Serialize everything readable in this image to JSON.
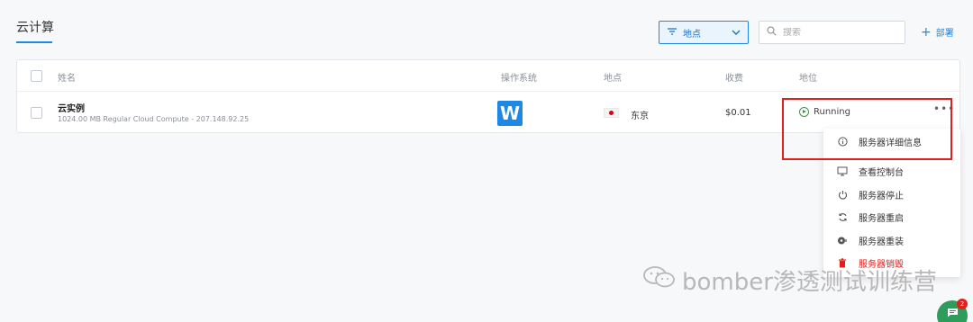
{
  "header": {
    "tab_title": "云计算",
    "filter_label": "地点",
    "search_placeholder": "搜索",
    "deploy_label": "部署"
  },
  "table": {
    "columns": [
      "姓名",
      "操作系统",
      "地点",
      "收费",
      "地位"
    ],
    "rows": [
      {
        "name": "云实例",
        "description": "1024.00 MB Regular Cloud Compute - 207.148.92.25",
        "os_logo": "W",
        "location": "东京",
        "fee": "$0.01",
        "status": "Running"
      }
    ]
  },
  "menu": {
    "items": [
      {
        "label": "服务器详细信息",
        "icon": "info-icon"
      },
      {
        "label": "查看控制台",
        "icon": "monitor-icon"
      },
      {
        "label": "服务器停止",
        "icon": "power-icon"
      },
      {
        "label": "服务器重启",
        "icon": "restart-icon"
      },
      {
        "label": "服务器重装",
        "icon": "reinstall-icon"
      },
      {
        "label": "服务器销毁",
        "icon": "trash-icon"
      }
    ]
  },
  "watermark": "bomber渗透测试训练营",
  "chat": {
    "badge_count": "2"
  },
  "colors": {
    "accent": "#1e88e5",
    "running": "#2e9d3a",
    "danger": "#e0201c",
    "highlight_border": "#e0201c"
  }
}
